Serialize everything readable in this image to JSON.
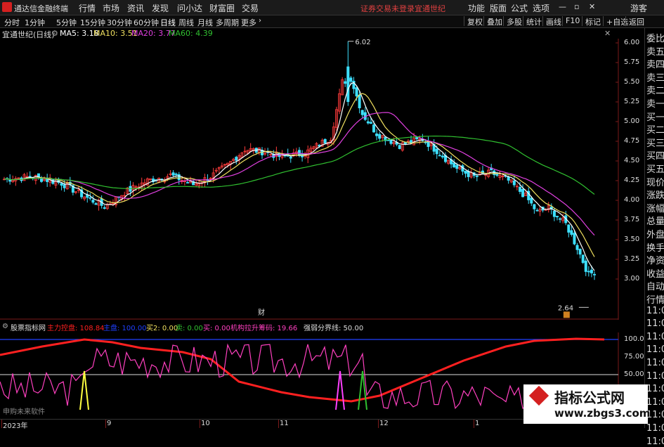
{
  "menubar": {
    "app_title": "通达信金融终端",
    "menus": [
      "行情",
      "市场",
      "资讯",
      "发现",
      "问小达",
      "财富圈",
      "交易"
    ],
    "status_login": "证券交易未登录",
    "stock_name": "宜通世纪",
    "right_menus": [
      "功能",
      "版面",
      "公式",
      "选项"
    ],
    "guest": "游客"
  },
  "periodbar": {
    "periods": [
      "分时",
      "1分钟",
      "5分钟",
      "15分钟",
      "30分钟",
      "60分钟",
      "日线",
      "周线",
      "月线",
      "多周期",
      "更多"
    ],
    "active_period": "日线",
    "tools": [
      "复权",
      "叠加",
      "多股",
      "统计",
      "画线",
      "F10",
      "标记",
      "+自选",
      "返回"
    ]
  },
  "info": {
    "title": "宜通世纪(日线)",
    "ma5": "MA5: 3.18",
    "ma10": "MA10: 3.51",
    "ma20": "MA20: 3.77",
    "ma60": "MA60: 4.39"
  },
  "price_axis": [
    "6.00",
    "5.75",
    "5.50",
    "5.25",
    "5.00",
    "4.75",
    "4.50",
    "4.25",
    "4.00",
    "3.75",
    "3.50",
    "3.25",
    "3.00"
  ],
  "annotations": {
    "high": "6.02",
    "low": "2.64",
    "fin_marker": "财"
  },
  "right_panel": {
    "labels": [
      "委比",
      "卖五",
      "卖四",
      "卖三",
      "卖二",
      "卖一",
      "买一",
      "买二",
      "买三",
      "买四",
      "买五",
      "现价",
      "涨跌",
      "涨幅",
      "总量",
      "外盘",
      "换手",
      "净资",
      "收益",
      "自动",
      "行情",
      "11:0",
      "11:0",
      "11:0",
      "11:0",
      "11:0",
      "11:0",
      "11:0",
      "11:0",
      "11:0",
      "11:0",
      "11:0"
    ]
  },
  "indicator": {
    "name": "股票指标网",
    "main_force": "主力控盘: 108.84",
    "label_blue": "主盘: 100.00",
    "buy2": "买2: 0.00",
    "sell": "卖: 0.00",
    "buy": "买: 0.00",
    "institution": "机构拉升筹码: 19.66",
    "boundary": "强弱分界线: 50.00",
    "axis": [
      "100.0",
      "75.00",
      "50.00"
    ],
    "footer_text": "申购未来软件"
  },
  "date_axis": [
    "2023年",
    "9",
    "10",
    "11",
    "12",
    "1"
  ],
  "watermark": {
    "title": "指标公式网",
    "url": "www.zbgs3.com"
  },
  "colors": {
    "up": "#ff3b3b",
    "down": "#3de0ff",
    "ma5": "#ffffff",
    "ma10": "#f0e060",
    "ma20": "#e040e0",
    "ma60": "#30c030",
    "main_force": "#ff2020",
    "inst": "#ff40c0"
  }
}
